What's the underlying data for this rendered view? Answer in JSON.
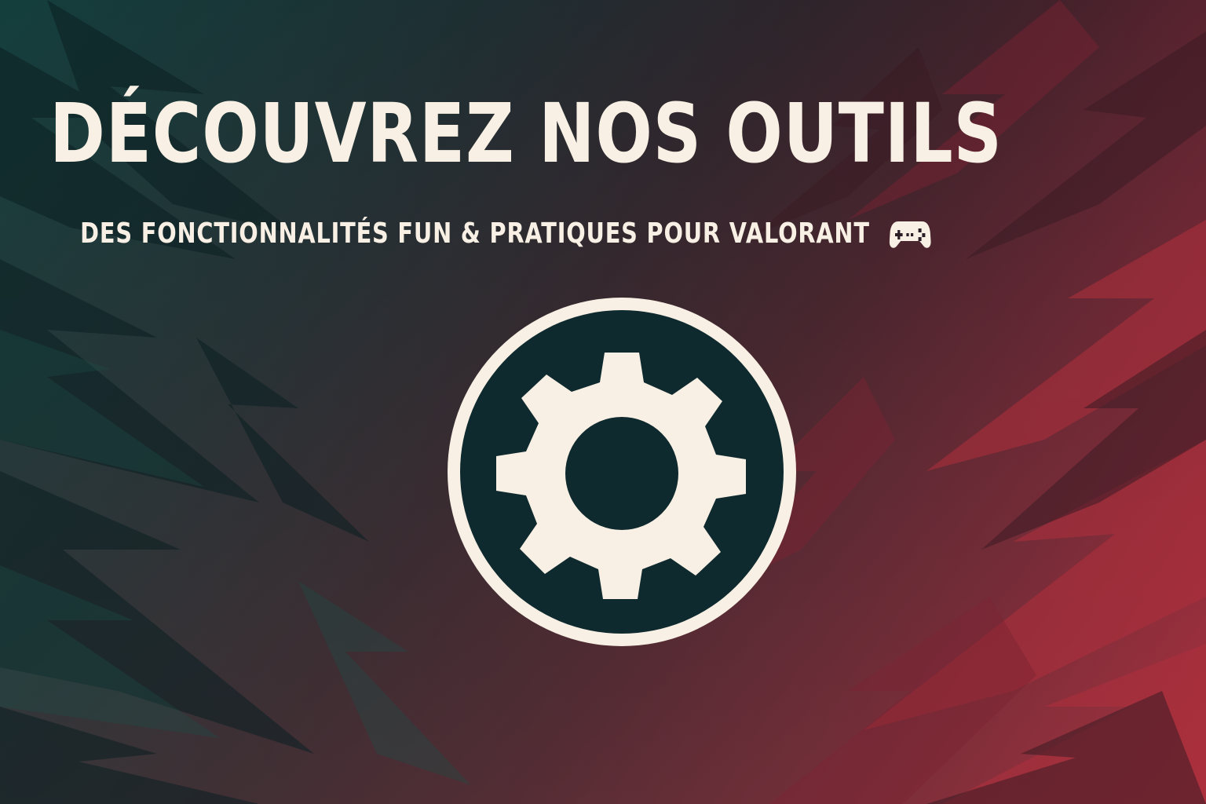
{
  "banner": {
    "title": "DÉCOUVREZ NOS OUTILS",
    "subtitle": "DES FONCTIONNALITÉS FUN & PRATIQUES POUR VALORANT",
    "subtitle_icon": "gamepad-icon",
    "center_icon": "gear-icon"
  },
  "colors": {
    "text": "#f8f0e4",
    "badge_fill": "#0f2a2f",
    "gradient_left": "#123a39",
    "gradient_right": "#a52a3b"
  }
}
